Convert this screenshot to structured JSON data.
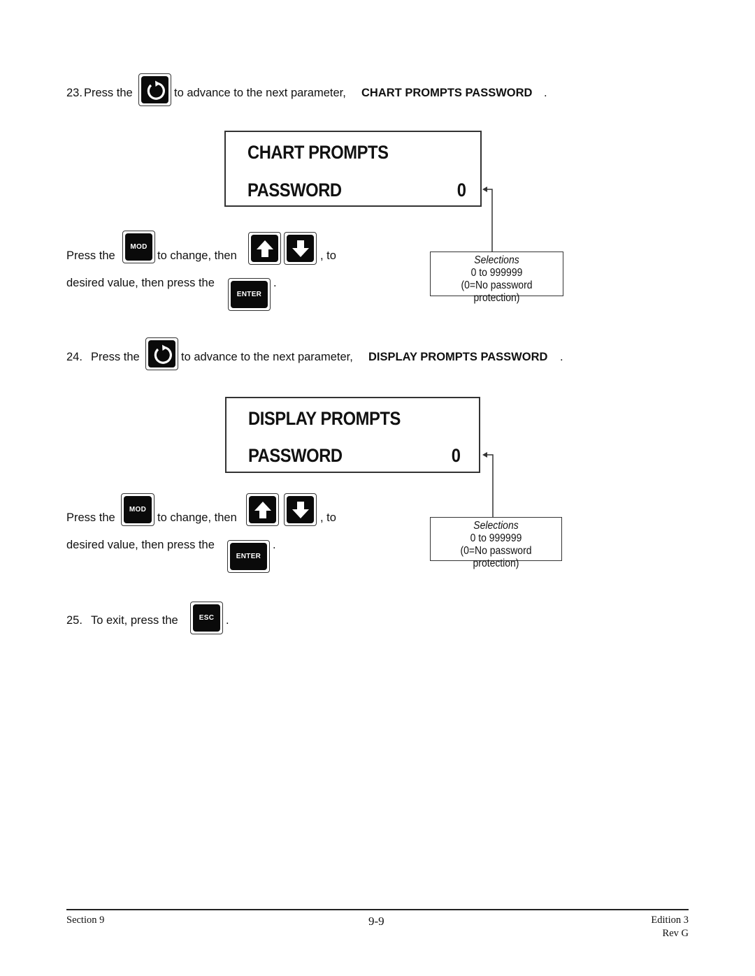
{
  "steps": [
    {
      "number": "23.",
      "press_the": "Press the",
      "key_icon": "scroll-advance-icon",
      "advance_text": "to advance to the next parameter,",
      "parameter_name": "CHART PROMPTS PASSWORD",
      "period": ".",
      "display": {
        "line1": "CHART  PROMPTS",
        "line2": "PASSWORD",
        "value": "0"
      },
      "instructions": {
        "press_the": "Press  the",
        "mod_key": "MOD",
        "to_change_then": "to change, then",
        "to": ", to",
        "desired_value": "desired value, then press the",
        "enter_key": "ENTER",
        "period": "."
      },
      "selections": {
        "title": "Selections",
        "range": "0 to 999999",
        "note": "(0=No password protection)"
      }
    },
    {
      "number": "24.",
      "press_the": "Press the",
      "key_icon": "scroll-advance-icon",
      "advance_text": "to advance to the next parameter,",
      "parameter_name": "DISPLAY PROMPTS PASSWORD",
      "period": ".",
      "display": {
        "line1": "DISPLAY  PROMPTS",
        "line2": "PASSWORD",
        "value": "0"
      },
      "instructions": {
        "press_the": "Press  the",
        "mod_key": "MOD",
        "to_change_then": "to change, then",
        "to": ", to",
        "desired_value": "desired value, then press the",
        "enter_key": "ENTER",
        "period": "."
      },
      "selections": {
        "title": "Selections",
        "range": "0 to 999999",
        "note": "(0=No password protection)"
      }
    },
    {
      "number": "25.",
      "text": "To exit, press the",
      "esc_key": "ESC",
      "period": "."
    }
  ],
  "footer": {
    "section": "Section 9",
    "page": "9-9",
    "edition": "Edition 3",
    "revision": "Rev G"
  }
}
